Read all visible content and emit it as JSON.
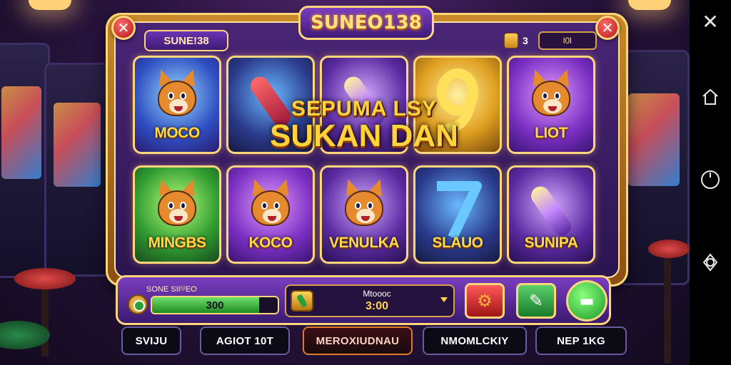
{
  "game": {
    "logo_text": "SUNEO138",
    "brand_tab": "SUNE!38",
    "counter_value": "3",
    "counter_label": "Ɩ0Ɩ",
    "title_line1": "SEPUMA LSY",
    "title_line2": "SUKAN DAN"
  },
  "reels": [
    {
      "label": "MOCO",
      "style": "blue",
      "symbol": "fox-icon"
    },
    {
      "label": "",
      "style": "night",
      "symbol": "gem-icon"
    },
    {
      "label": "",
      "style": "violet",
      "symbol": "wand-icon"
    },
    {
      "label": "",
      "style": "gold",
      "symbol": "gold-nine-icon"
    },
    {
      "label": "LIOT",
      "style": "purple",
      "symbol": "fox-icon"
    },
    {
      "label": "MINGBS",
      "style": "green",
      "symbol": "fox-icon"
    },
    {
      "label": "KOCO",
      "style": "purple",
      "symbol": "fox-icon"
    },
    {
      "label": "VENULKA",
      "style": "violet",
      "symbol": "fox-icon"
    },
    {
      "label": "SLAUO",
      "style": "night",
      "symbol": "blue-seven-icon"
    },
    {
      "label": "SUNIPA",
      "style": "violet",
      "symbol": "wand-icon"
    }
  ],
  "controls": {
    "balance_caption": "SONE SII⁽ʲ⁾EO",
    "balance_value": "300",
    "balance_fill": 0.85,
    "bet_caption": "Mtoooc",
    "bet_value": "3:00",
    "settings_icon": "gear-icon",
    "auto_icon": "pencil-icon",
    "spin_icon": "spin-icon"
  },
  "menu": [
    {
      "label": "SVIJU",
      "active": false
    },
    {
      "label": "AGIOT 10T",
      "active": false
    },
    {
      "label": "MEROXIUDNAU",
      "active": true
    },
    {
      "label": "NMOMLCKIY",
      "active": false
    },
    {
      "label": "NEP 1KG",
      "active": false
    }
  ],
  "nav": {
    "close_icon": "close-icon",
    "home_icon": "home-icon",
    "circle_icon": "power-icon",
    "rotate_icon": "rotate-icon"
  },
  "colors": {
    "frame_gold": "#ffd77a",
    "panel_purple": "#4a2576",
    "label_yellow": "#ffd84a"
  }
}
